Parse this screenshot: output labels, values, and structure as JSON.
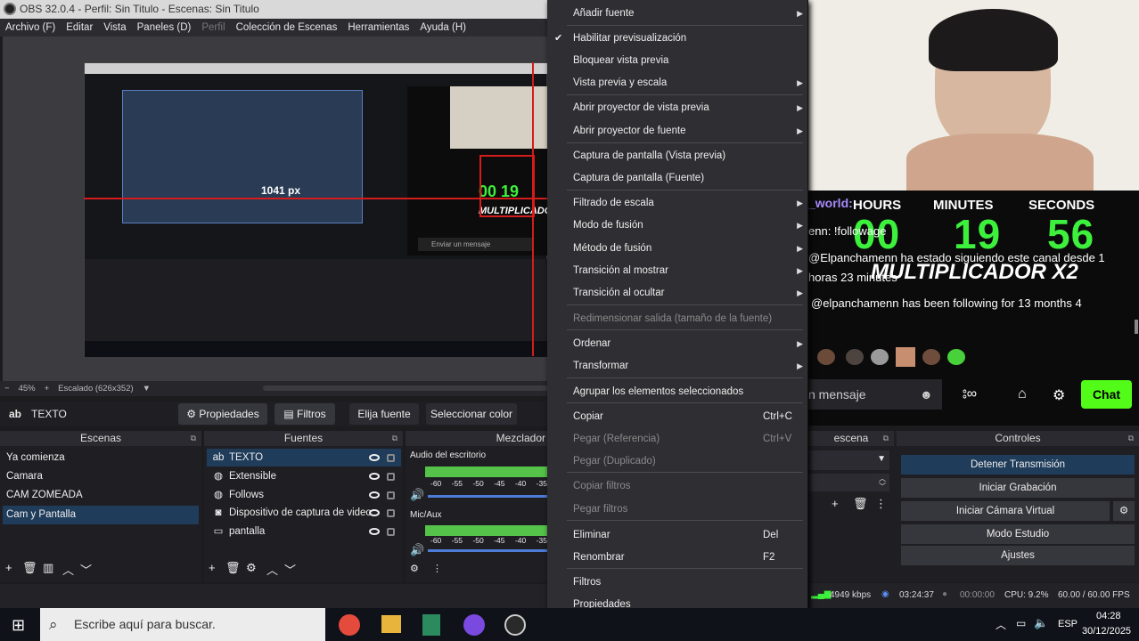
{
  "window": {
    "title": "OBS 32.0.4 - Perfil: Sin Titulo - Escenas: Sin Titulo"
  },
  "menubar": [
    "Archivo (F)",
    "Editar",
    "Vista",
    "Paneles (D)",
    "Perfil",
    "Colección de Escenas",
    "Herramientas",
    "Ayuda (H)"
  ],
  "preview": {
    "measure": "1041 px",
    "inner_multiplicador": "MULTIPLICADOR",
    "inner_message": "Enviar un mensaje"
  },
  "zoombar": {
    "minus": "−",
    "zoom": "45%",
    "plus": "+",
    "scale": "Escalado (626x352)"
  },
  "source_toolbar": {
    "source_name": "TEXTO",
    "properties": "Propiedades",
    "filters": "Filtros",
    "choose_source": "Elija fuente",
    "select_color": "Seleccionar color"
  },
  "docks": {
    "scenes_title": "Escenas",
    "sources_title": "Fuentes",
    "mixer_title": "Mezclador",
    "transitions_title": "escena",
    "controls_title": "Controles"
  },
  "scenes": [
    "Ya comienza",
    "Camara",
    "CAM ZOMEADA",
    "Cam y Pantalla"
  ],
  "sources": [
    {
      "name": "TEXTO",
      "icon": "text-icon"
    },
    {
      "name": "Extensible",
      "icon": "globe-icon"
    },
    {
      "name": "Follows",
      "icon": "globe-icon"
    },
    {
      "name": "Dispositivo de captura de video",
      "icon": "camera-icon"
    },
    {
      "name": "pantalla",
      "icon": "monitor-icon"
    }
  ],
  "mixer": {
    "ch1": "Audio del escritorio",
    "ch2": "Mic/Aux",
    "ticks": [
      "-60",
      "-55",
      "-50",
      "-45",
      "-40",
      "-35"
    ]
  },
  "context_menu": {
    "items": [
      {
        "label": "Añadir fuente",
        "submenu": true
      },
      {
        "label": "Habilitar previsualización",
        "checked": true
      },
      {
        "label": "Bloquear vista previa"
      },
      {
        "label": "Vista previa y escala",
        "submenu": true
      },
      {
        "label": "Abrir proyector de vista previa",
        "submenu": true
      },
      {
        "label": "Abrir proyector de fuente",
        "submenu": true
      },
      {
        "label": "Captura de pantalla (Vista previa)"
      },
      {
        "label": "Captura de pantalla (Fuente)"
      },
      {
        "label": "Filtrado de escala",
        "submenu": true
      },
      {
        "label": "Modo de fusión",
        "submenu": true
      },
      {
        "label": "Método de fusión",
        "submenu": true
      },
      {
        "label": "Transición al mostrar",
        "submenu": true
      },
      {
        "label": "Transición al ocultar",
        "submenu": true
      },
      {
        "label": "Redimensionar salida (tamaño de la fuente)",
        "disabled": true
      },
      {
        "label": "Ordenar",
        "submenu": true
      },
      {
        "label": "Transformar",
        "submenu": true
      },
      {
        "label": "Agrupar los elementos seleccionados"
      },
      {
        "label": "Copiar",
        "shortcut": "Ctrl+C"
      },
      {
        "label": "Pegar (Referencia)",
        "shortcut": "Ctrl+V",
        "disabled": true
      },
      {
        "label": "Pegar (Duplicado)",
        "disabled": true
      },
      {
        "label": "Copiar filtros",
        "disabled": true
      },
      {
        "label": "Pegar filtros",
        "disabled": true
      },
      {
        "label": "Eliminar",
        "shortcut": "Del"
      },
      {
        "label": "Renombrar",
        "shortcut": "F2"
      },
      {
        "label": "Filtros"
      },
      {
        "label": "Propiedades"
      }
    ]
  },
  "overlay": {
    "user_fragment": "_world:",
    "hours_label": "HOURS",
    "minutes_label": "MINUTES",
    "seconds_label": "SECONDS",
    "hours": "00",
    "minutes": "19",
    "seconds": "56",
    "line1": "enn: !followage",
    "line2": "@Elpanchamenn ha estado siguiendo este canal desde 1",
    "line3": "horas 23 minutes",
    "multiplicador": "MULTIPLICADOR X2",
    "follow_msg": "@elpanchamenn has been following for 13 months 4",
    "chat_input": "n mensaje",
    "chat_button": "Chat"
  },
  "controls": {
    "stop_stream": "Detener Transmisión",
    "start_record": "Iniciar Grabación",
    "start_virtualcam": "Iniciar Cámara Virtual",
    "studio_mode": "Modo Estudio",
    "settings": "Ajustes"
  },
  "status": {
    "bitrate": "4949 kbps",
    "stream_time": "03:24:37",
    "rec_time": "00:00:00",
    "cpu": "CPU: 9.2%",
    "fps": "60.00 / 60.00 FPS"
  },
  "taskbar": {
    "search_placeholder": "Escribe aquí para buscar.",
    "lang": "ESP",
    "time": "04:28",
    "date": "30/12/2025"
  },
  "colors": {
    "accent_green": "#3cf03c",
    "selection_blue": "#1f3c5a",
    "chat_green": "#53fc18",
    "guide_red": "#d41c1c"
  }
}
